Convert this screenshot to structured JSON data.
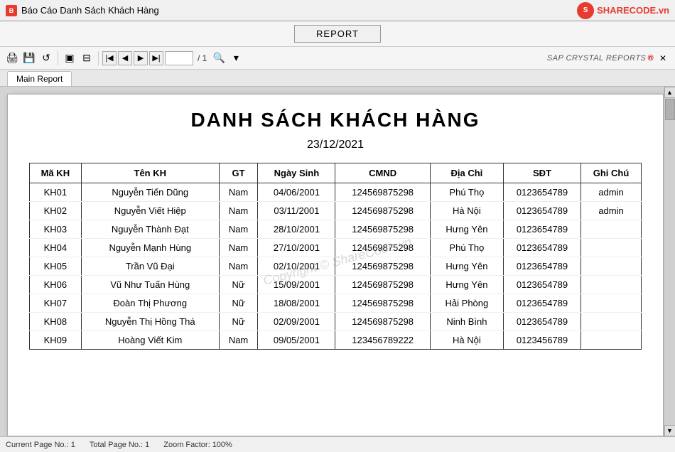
{
  "window": {
    "title": "Báo Cáo Danh Sách Khách Hàng"
  },
  "logo": {
    "icon_char": "S",
    "text_before": "SHARECODE",
    "text_after": ".vn"
  },
  "toolbar": {
    "report_button": "REPORT"
  },
  "icon_toolbar": {
    "page_current": "1",
    "page_total": "/ 1",
    "sap_label": "SAP CRYSTAL REPORTS",
    "sap_r": "®"
  },
  "tabs": [
    {
      "label": "Main Report",
      "active": true
    }
  ],
  "report": {
    "title": "DANH SÁCH KHÁCH HÀNG",
    "date": "23/12/2021",
    "table": {
      "headers": [
        "Mã KH",
        "Tên KH",
        "GT",
        "Ngày Sinh",
        "CMND",
        "Địa Chỉ",
        "SĐT",
        "Ghi Chú"
      ],
      "rows": [
        [
          "KH01",
          "Nguyễn Tiến Dũng",
          "Nam",
          "04/06/2001",
          "124569875298",
          "Phú Thọ",
          "0123654789",
          "admin"
        ],
        [
          "KH02",
          "Nguyễn Viết Hiệp",
          "Nam",
          "03/11/2001",
          "124569875298",
          "Hà Nội",
          "0123654789",
          "admin"
        ],
        [
          "KH03",
          "Nguyễn Thành Đạt",
          "Nam",
          "28/10/2001",
          "124569875298",
          "Hưng Yên",
          "0123654789",
          ""
        ],
        [
          "KH04",
          "Nguyễn Mạnh Hùng",
          "Nam",
          "27/10/2001",
          "124569875298",
          "Phú Thọ",
          "0123654789",
          ""
        ],
        [
          "KH05",
          "Trần Vũ Đại",
          "Nam",
          "02/10/2001",
          "124569875298",
          "Hưng Yên",
          "0123654789",
          ""
        ],
        [
          "KH06",
          "Vũ Như Tuấn Hùng",
          "Nữ",
          "15/09/2001",
          "124569875298",
          "Hưng Yên",
          "0123654789",
          ""
        ],
        [
          "KH07",
          "Đoàn Thị Phương",
          "Nữ",
          "18/08/2001",
          "124569875298",
          "Hải Phòng",
          "0123654789",
          ""
        ],
        [
          "KH08",
          "Nguyễn Thị Hồng Thá",
          "Nữ",
          "02/09/2001",
          "124569875298",
          "Ninh Bình",
          "0123654789",
          ""
        ],
        [
          "KH09",
          "Hoàng Viết Kim",
          "Nam",
          "09/05/2001",
          "123456789222",
          "Hà Nội",
          "0123456789",
          ""
        ]
      ]
    }
  },
  "status_bar": {
    "current_page_label": "Current Page No.: 1",
    "total_page_label": "Total Page No.: 1",
    "zoom_label": "Zoom Factor: 100%"
  },
  "watermark": "Copyright © ShareCode.vn"
}
